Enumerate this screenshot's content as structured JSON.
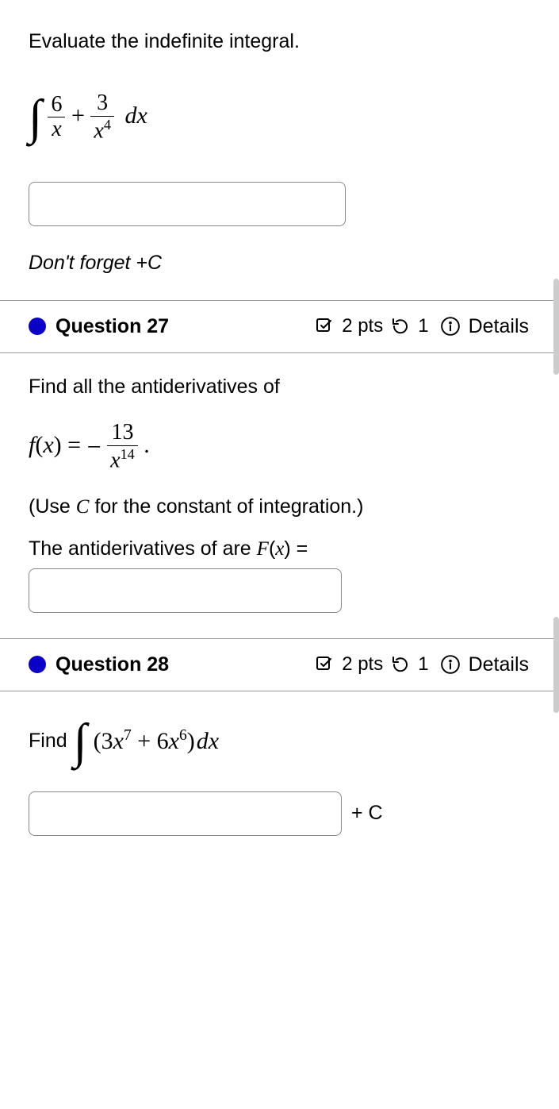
{
  "q26": {
    "prompt": "Evaluate the indefinite integral.",
    "integral_num1": "6",
    "integral_den1": "x",
    "integral_num2": "3",
    "integral_den2_base": "x",
    "integral_den2_exp": "4",
    "dx": "dx",
    "hint": "Don't forget +C"
  },
  "q27": {
    "title": "Question 27",
    "points": "2 pts",
    "attempts": "1",
    "details": "Details",
    "prompt": "Find all the antiderivatives of",
    "fx_lhs": "f(x) = ",
    "frac_num": "13",
    "frac_den_base": "x",
    "frac_den_exp": "14",
    "period": ".",
    "use_c": "(Use C for the constant of integration.)",
    "answer_label": "The antiderivatives of are F(x) ="
  },
  "q28": {
    "title": "Question 28",
    "points": "2 pts",
    "attempts": "1",
    "details": "Details",
    "find": "Find",
    "coef1": "3",
    "base1": "x",
    "exp1": "7",
    "plus": " + ",
    "coef2": "6",
    "base2": "x",
    "exp2": "6",
    "dx": "dx",
    "suffix": "+ C"
  }
}
